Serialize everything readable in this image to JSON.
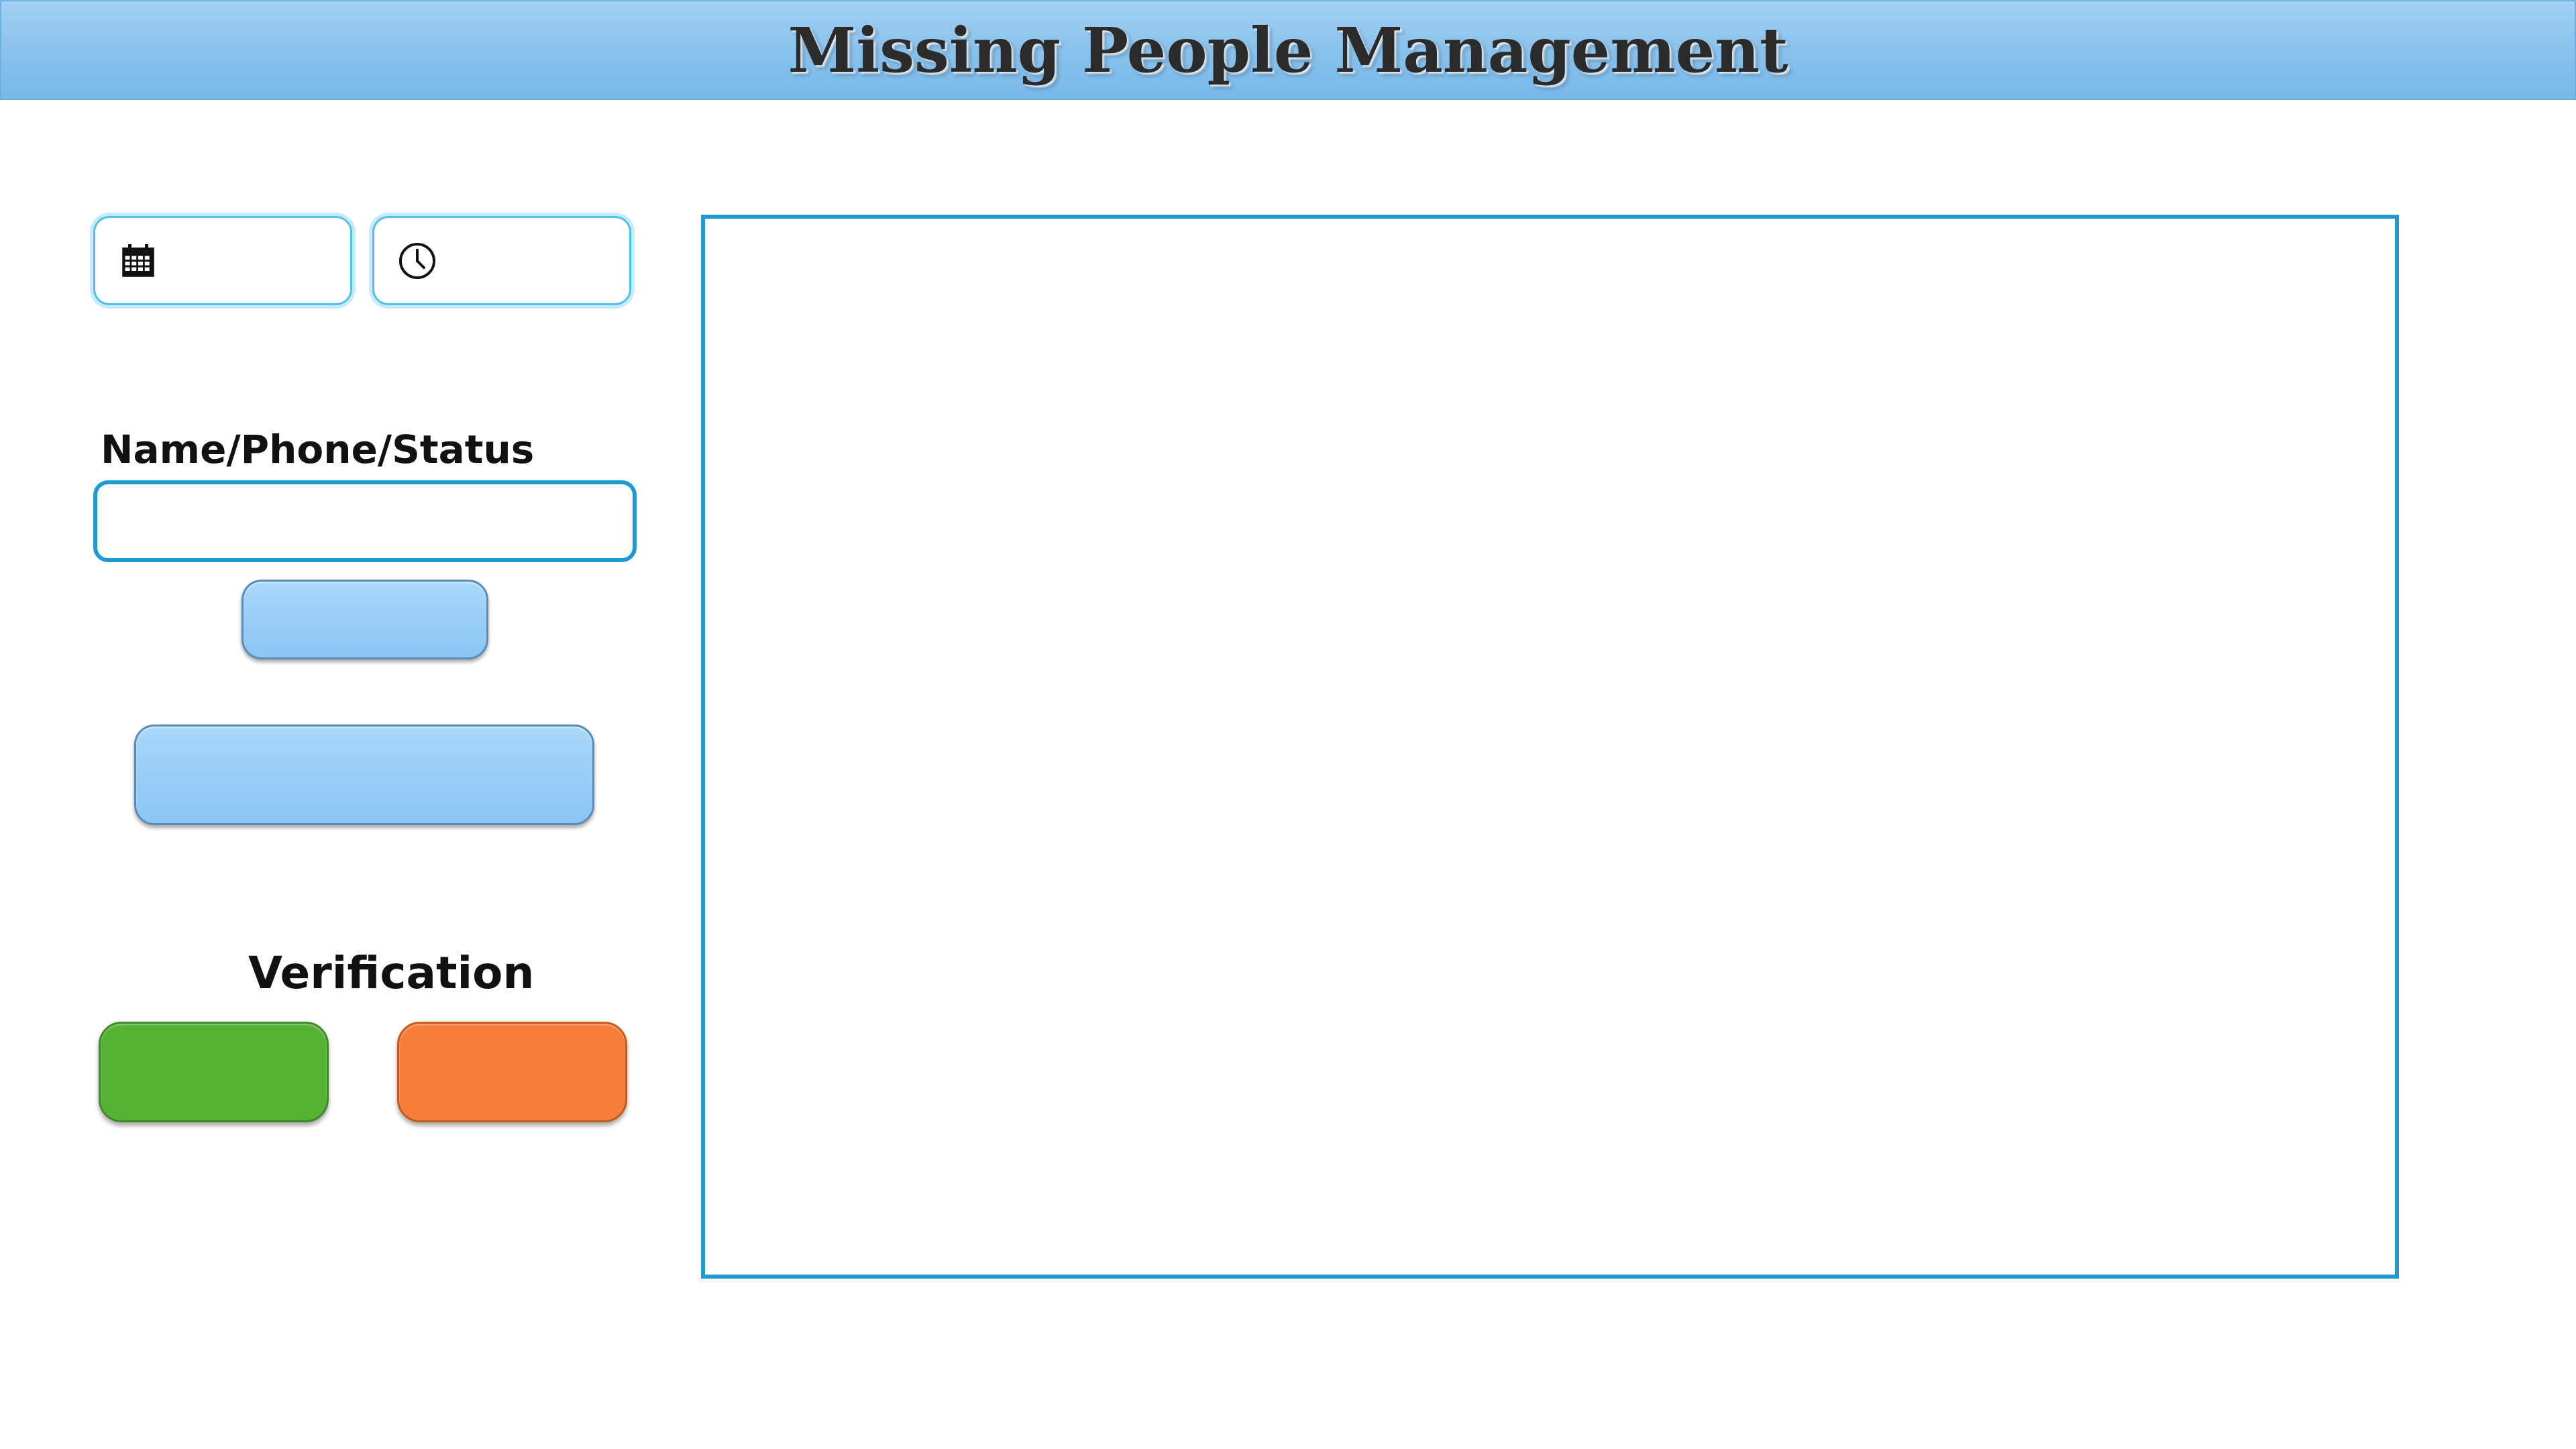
{
  "header": {
    "title": "Missing People Management"
  },
  "filters": {
    "date_icon": "calendar-icon",
    "date_value": "",
    "time_icon": "clock-icon",
    "time_value": ""
  },
  "search": {
    "label": "Name/Phone/Status",
    "value": "",
    "placeholder": "",
    "button_label": ""
  },
  "actions": {
    "wide_button_label": ""
  },
  "verification": {
    "label": "Verification",
    "approve_label": "",
    "approve_color": "#56b235",
    "reject_label": "",
    "reject_color": "#f77d3a"
  },
  "theme": {
    "header_blue": "#87c1ec",
    "border_blue": "#1e9ad2",
    "button_blue": "#99cdf7"
  }
}
